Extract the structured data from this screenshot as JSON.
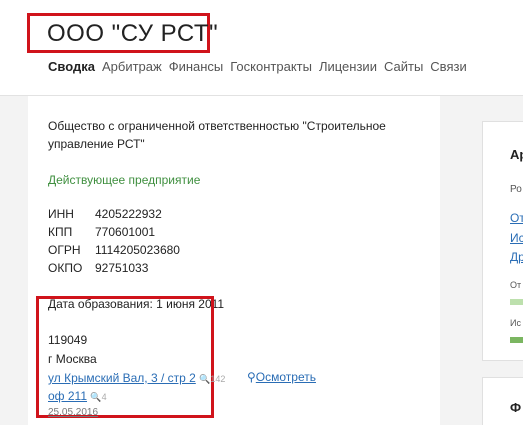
{
  "header": {
    "company_title": "ООО \"СУ РСТ\"",
    "tabs": [
      {
        "label": "Сводка"
      },
      {
        "label": "Арбитраж"
      },
      {
        "label": "Финансы"
      },
      {
        "label": "Госконтракты"
      },
      {
        "label": "Лицензии"
      },
      {
        "label": "Сайты"
      },
      {
        "label": "Связи"
      }
    ]
  },
  "main": {
    "full_name": "Общество с ограниченной ответственностью \"Строительное управление РСТ\"",
    "status": "Действующее предприятие",
    "requisites": [
      {
        "label": "ИНН",
        "value": "4205222932"
      },
      {
        "label": "КПП",
        "value": "770601001"
      },
      {
        "label": "ОГРН",
        "value": "1114205023680"
      },
      {
        "label": "ОКПО",
        "value": "92751033"
      }
    ],
    "founded": "Дата образования: 1 июня 2011",
    "address": {
      "postcode": "119049",
      "city": "г Москва",
      "street": "ул Крымский Вал, 3 / стр 2",
      "street_count": "142",
      "office": "оф 211",
      "office_count": "4",
      "see_label": "Осмотреть",
      "date": "25.05.2016"
    }
  },
  "sidebar": {
    "title": "Ар",
    "sub": "Ро",
    "links": [
      "От",
      "Ис",
      "Др"
    ],
    "small1": "От",
    "small2": "Ис",
    "card2_title": "Ф"
  },
  "colors": {
    "accent_red": "#d0131b",
    "status_green": "#3f8f3f",
    "link_blue": "#2a6db5",
    "bar_green": "#7bb661"
  }
}
